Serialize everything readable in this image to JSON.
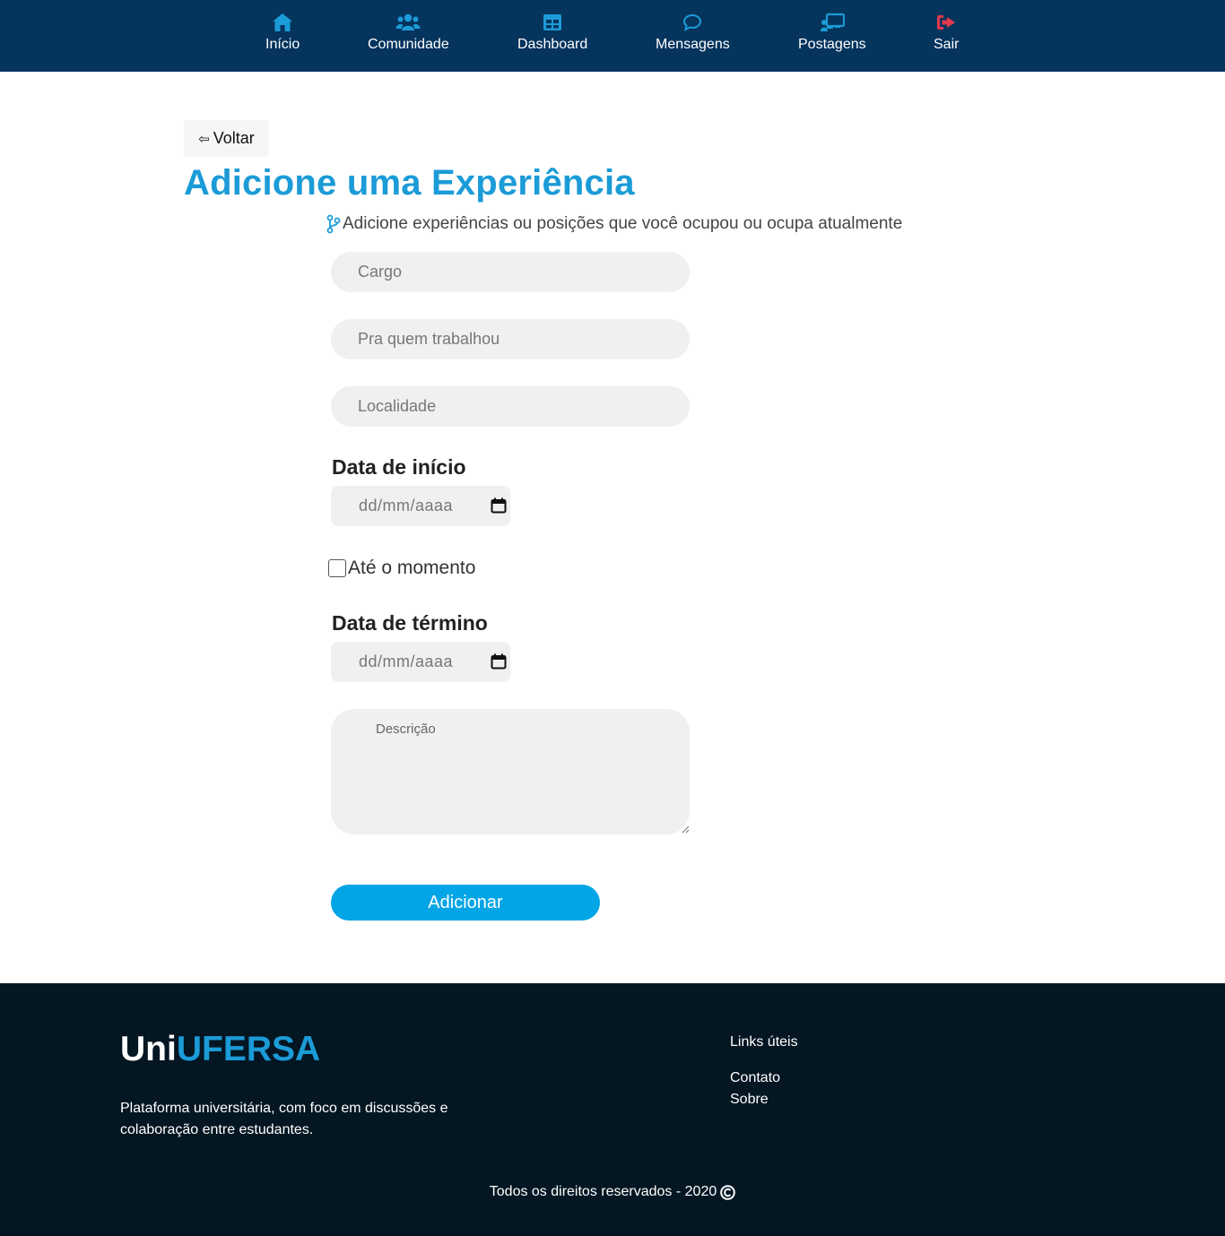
{
  "nav": {
    "items": [
      {
        "label": "Início",
        "icon": "home-icon"
      },
      {
        "label": "Comunidade",
        "icon": "users-icon"
      },
      {
        "label": "Dashboard",
        "icon": "table-icon"
      },
      {
        "label": "Mensagens",
        "icon": "chat-bubble-icon"
      },
      {
        "label": "Postagens",
        "icon": "presentation-icon"
      },
      {
        "label": "Sair",
        "icon": "sign-out-icon"
      }
    ],
    "colors": {
      "background": "#05345d",
      "icon": "#1b9bd7",
      "logout_icon": "#e03a4d"
    }
  },
  "main": {
    "back_label": "Voltar",
    "back_icon": "arrow-left-icon",
    "title": "Adicione uma Experiência",
    "subtitle_icon": "code-branch-icon",
    "subtitle": "Adicione experiências ou posições que você ocupou ou ocupa atualmente",
    "fields": {
      "cargo_placeholder": "Cargo",
      "employer_placeholder": "Pra quem trabalhou",
      "location_placeholder": "Localidade",
      "start_label": "Data de início",
      "start_placeholder": "dd/mm/aaaa",
      "current_label": "Até o momento",
      "end_label": "Data de término",
      "end_placeholder": "dd/mm/aaaa",
      "description_placeholder": "Descrição"
    },
    "submit_label": "Adicionar",
    "colors": {
      "accent": "#1b9bd7",
      "button": "#02a5e6",
      "input_bg": "#f0f0f0"
    }
  },
  "footer": {
    "brand_part1": "Uni",
    "brand_part2": "UFERSA",
    "description": "Plataforma universitária, com foco em discussões e colaboração entre estudantes.",
    "links_title": "Links úteis",
    "links": [
      "Contato",
      "Sobre"
    ],
    "copyright": "Todos os direitos reservados - 2020",
    "colors": {
      "background": "#031622"
    }
  }
}
